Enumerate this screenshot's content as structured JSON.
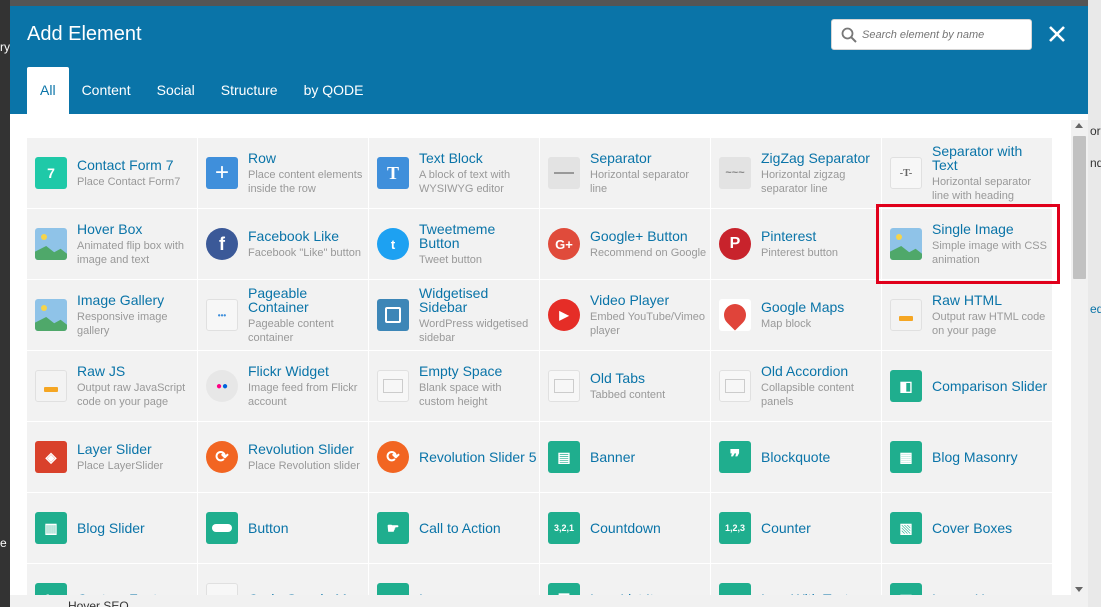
{
  "background": {
    "right_texts": [
      "ord",
      "nd",
      "ed"
    ],
    "left_texts": [
      "ry",
      "e"
    ],
    "bottom_text": "Hover SEO"
  },
  "modal": {
    "title": "Add Element",
    "search_placeholder": "Search element by name",
    "tabs": [
      "All",
      "Content",
      "Social",
      "Structure",
      "by QODE"
    ],
    "active_tab": "All"
  },
  "elements": [
    {
      "name": "Contact Form 7",
      "desc": "Place Contact Form7",
      "icon": "contact-form-7-icon"
    },
    {
      "name": "Row",
      "desc": "Place content elements inside the row",
      "icon": "plus-icon"
    },
    {
      "name": "Text Block",
      "desc": "A block of text with WYSIWYG editor",
      "icon": "text-t-icon"
    },
    {
      "name": "Separator",
      "desc": "Horizontal separator line",
      "icon": "separator-line-icon"
    },
    {
      "name": "ZigZag Separator",
      "desc": "Horizontal zigzag separator line",
      "icon": "zigzag-icon"
    },
    {
      "name": "Separator with Text",
      "desc": "Horizontal separator line with heading",
      "icon": "separator-text-icon"
    },
    {
      "name": "Hover Box",
      "desc": "Animated flip box with image and text",
      "icon": "hover-box-icon"
    },
    {
      "name": "Facebook Like",
      "desc": "Facebook \"Like\" button",
      "icon": "facebook-icon"
    },
    {
      "name": "Tweetmeme Button",
      "desc": "Tweet button",
      "icon": "twitter-icon"
    },
    {
      "name": "Google+ Button",
      "desc": "Recommend on Google",
      "icon": "google-plus-icon"
    },
    {
      "name": "Pinterest",
      "desc": "Pinterest button",
      "icon": "pinterest-icon"
    },
    {
      "name": "Single Image",
      "desc": "Simple image with CSS animation",
      "icon": "image-icon"
    },
    {
      "name": "Image Gallery",
      "desc": "Responsive image gallery",
      "icon": "image-gallery-icon"
    },
    {
      "name": "Pageable Container",
      "desc": "Pageable content container",
      "icon": "pageable-container-icon"
    },
    {
      "name": "Widgetised Sidebar",
      "desc": "WordPress widgetised sidebar",
      "icon": "sidebar-icon"
    },
    {
      "name": "Video Player",
      "desc": "Embed YouTube/Vimeo player",
      "icon": "play-icon"
    },
    {
      "name": "Google Maps",
      "desc": "Map block",
      "icon": "map-pin-icon"
    },
    {
      "name": "Raw HTML",
      "desc": "Output raw HTML code on your page",
      "icon": "raw-html-icon"
    },
    {
      "name": "Raw JS",
      "desc": "Output raw JavaScript code on your page",
      "icon": "raw-js-icon"
    },
    {
      "name": "Flickr Widget",
      "desc": "Image feed from Flickr account",
      "icon": "flickr-icon"
    },
    {
      "name": "Empty Space",
      "desc": "Blank space with custom height",
      "icon": "empty-space-icon"
    },
    {
      "name": "Old Tabs",
      "desc": "Tabbed content",
      "icon": "tabs-icon"
    },
    {
      "name": "Old Accordion",
      "desc": "Collapsible content panels",
      "icon": "accordion-icon"
    },
    {
      "name": "Comparison Slider",
      "desc": "",
      "icon": "comparison-slider-icon"
    },
    {
      "name": "Layer Slider",
      "desc": "Place LayerSlider",
      "icon": "layers-icon"
    },
    {
      "name": "Revolution Slider",
      "desc": "Place Revolution slider",
      "icon": "revolution-icon"
    },
    {
      "name": "Revolution Slider 5",
      "desc": "",
      "icon": "revolution-icon"
    },
    {
      "name": "Banner",
      "desc": "",
      "icon": "banner-icon"
    },
    {
      "name": "Blockquote",
      "desc": "",
      "icon": "quote-icon"
    },
    {
      "name": "Blog Masonry",
      "desc": "",
      "icon": "masonry-icon"
    },
    {
      "name": "Blog Slider",
      "desc": "",
      "icon": "blog-slider-icon"
    },
    {
      "name": "Button",
      "desc": "",
      "icon": "button-icon"
    },
    {
      "name": "Call to Action",
      "desc": "",
      "icon": "call-to-action-icon"
    },
    {
      "name": "Countdown",
      "desc": "",
      "icon": "countdown-icon"
    },
    {
      "name": "Counter",
      "desc": "",
      "icon": "counter-icon"
    },
    {
      "name": "Cover Boxes",
      "desc": "",
      "icon": "cover-boxes-icon"
    },
    {
      "name": "Custom Font",
      "desc": "",
      "icon": "custom-font-icon"
    },
    {
      "name": "Qode Google Map",
      "desc": "",
      "icon": "qode-google-map-icon"
    },
    {
      "name": "Icon",
      "desc": "",
      "icon": "icon-icon"
    },
    {
      "name": "Icon List Item",
      "desc": "",
      "icon": "icon-list-icon"
    },
    {
      "name": "Icon With Text",
      "desc": "",
      "icon": "icon-with-text-icon"
    },
    {
      "name": "Image Hover",
      "desc": "",
      "icon": "image-hover-icon"
    }
  ],
  "highlighted": "Single Image"
}
